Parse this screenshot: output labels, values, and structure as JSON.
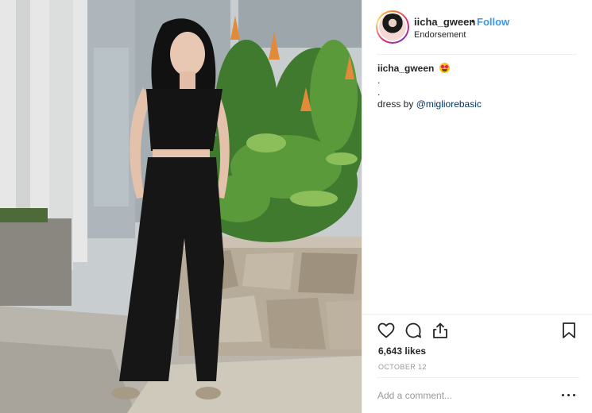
{
  "post": {
    "username": "iicha_gween",
    "separator": "•",
    "follow_label": "Follow",
    "sublabel": "Endorsement",
    "caption": {
      "username": "iicha_gween",
      "emoji": "star-struck-emoji",
      "dot1": ".",
      "dot2": ".",
      "dress_prefix": "dress by ",
      "mention": "@migliorebasic"
    },
    "likes": "6,643 likes",
    "date": "OCTOBER 12",
    "comment_placeholder": "Add a comment..."
  },
  "icons": {
    "like": "heart-icon",
    "comment": "comment-icon",
    "share": "share-icon",
    "save": "bookmark-icon",
    "more": "more-options-icon"
  },
  "colors": {
    "follow": "#3897f0",
    "mention": "#003569",
    "text": "#262626",
    "muted": "#999999",
    "divider": "#efefef"
  }
}
